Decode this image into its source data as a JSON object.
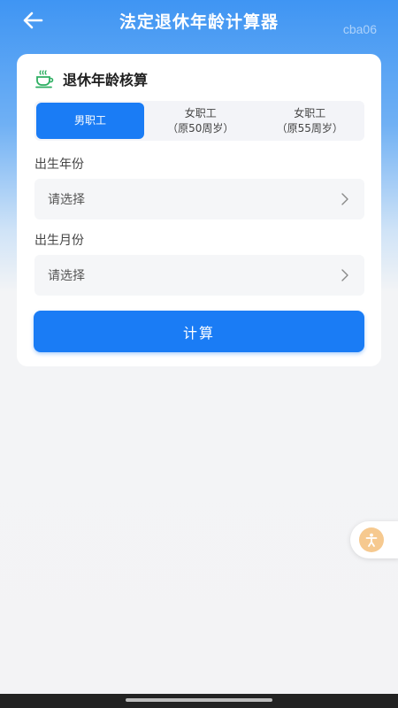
{
  "header": {
    "title": "法定退休年龄计算器",
    "watermark": "cba06"
  },
  "card": {
    "title": "退休年龄核算",
    "tabs": [
      {
        "line1": "男职工",
        "line2": "",
        "active": true
      },
      {
        "line1": "女职工",
        "line2": "（原50周岁）",
        "active": false
      },
      {
        "line1": "女职工",
        "line2": "（原55周岁）",
        "active": false
      }
    ],
    "birth_year": {
      "label": "出生年份",
      "placeholder": "请选择"
    },
    "birth_month": {
      "label": "出生月份",
      "placeholder": "请选择"
    },
    "calculate_label": "计算"
  },
  "colors": {
    "accent": "#1a7cf5",
    "header_gradient_top": "#3f95f3",
    "page_bg": "#f3f3f5",
    "float_badge": "#f6c98f"
  },
  "icons": [
    "back-arrow-icon",
    "tea-cup-icon",
    "chevron-right-icon",
    "accessibility-icon"
  ]
}
